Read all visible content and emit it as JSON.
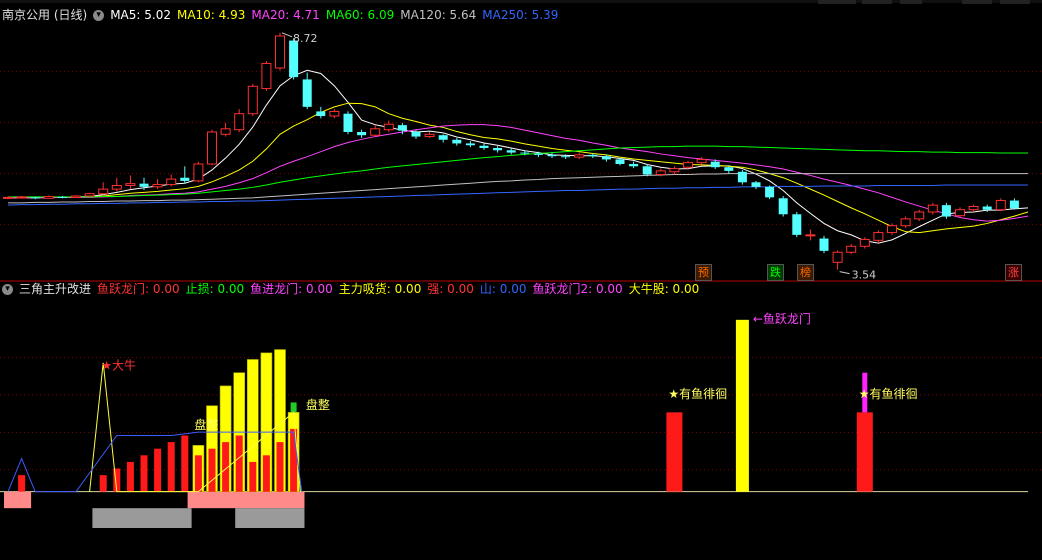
{
  "main_panel": {
    "stock_name": "南京公用 (日线)",
    "indicators": [
      {
        "label": "MA5: 5.02",
        "color": "#ffffff"
      },
      {
        "label": "MA10: 4.93",
        "color": "#ffff00"
      },
      {
        "label": "MA20: 4.71",
        "color": "#ff44ff"
      },
      {
        "label": "MA60: 6.09",
        "color": "#00ff00"
      },
      {
        "label": "MA120: 5.64",
        "color": "#c0c0c0"
      },
      {
        "label": "MA250: 5.39",
        "color": "#3366ff"
      }
    ],
    "high_label": "8.72",
    "low_label": "3.54",
    "signals": [
      {
        "text": "预",
        "color": "#ff6a00",
        "bg": "#3a1a00"
      },
      {
        "text": "跌",
        "color": "#00ff00",
        "bg": "#003a00"
      },
      {
        "text": "榜",
        "color": "#ff6a00",
        "bg": "#3a1a00"
      },
      {
        "text": "涨",
        "color": "#ff4444",
        "bg": "#3a0000"
      }
    ]
  },
  "sub_panel": {
    "name": "三角主升改进",
    "indicators": [
      {
        "label": "鱼跃龙门: 0.00",
        "color": "#ff3333"
      },
      {
        "label": "止损: 0.00",
        "color": "#00ff00"
      },
      {
        "label": "鱼进龙门: 0.00",
        "color": "#ff44ff"
      },
      {
        "label": "主力吸货: 0.00",
        "color": "#ffff00"
      },
      {
        "label": "强: 0.00",
        "color": "#ff3333"
      },
      {
        "label": "山: 0.00",
        "color": "#3366ff"
      },
      {
        "label": "鱼跃龙门2: 0.00",
        "color": "#ff44ff"
      },
      {
        "label": "大牛股: 0.00",
        "color": "#ffff00"
      }
    ],
    "annotations": {
      "da_niu": "★大牛",
      "pan_zheng_1": "盘整",
      "pan_zheng_2": "盘整",
      "yu_yue_long_men": "←鱼跃龙门",
      "you_yu_1": "★有鱼徘徊",
      "you_yu_2": "★有鱼徘徊"
    }
  },
  "colors": {
    "up": "#ff3030",
    "down": "#54ffff",
    "grid": "#7a0000",
    "axis": "#b40000"
  },
  "chart_data": {
    "type": "candlestick",
    "title": "南京公用 (日线)",
    "y_range": [
      3.4,
      9.0
    ],
    "candles": [
      {
        "o": 5.1,
        "c": 5.12,
        "h": 5.14,
        "l": 5.08
      },
      {
        "o": 5.11,
        "c": 5.13,
        "h": 5.15,
        "l": 5.09
      },
      {
        "o": 5.12,
        "c": 5.1,
        "h": 5.14,
        "l": 5.08
      },
      {
        "o": 5.1,
        "c": 5.14,
        "h": 5.16,
        "l": 5.09
      },
      {
        "o": 5.13,
        "c": 5.12,
        "h": 5.15,
        "l": 5.1
      },
      {
        "o": 5.12,
        "c": 5.15,
        "h": 5.17,
        "l": 5.11
      },
      {
        "o": 5.15,
        "c": 5.2,
        "h": 5.22,
        "l": 5.13
      },
      {
        "o": 5.2,
        "c": 5.3,
        "h": 5.45,
        "l": 5.18
      },
      {
        "o": 5.3,
        "c": 5.38,
        "h": 5.55,
        "l": 5.25
      },
      {
        "o": 5.38,
        "c": 5.42,
        "h": 5.6,
        "l": 5.3
      },
      {
        "o": 5.42,
        "c": 5.35,
        "h": 5.55,
        "l": 5.28
      },
      {
        "o": 5.35,
        "c": 5.4,
        "h": 5.52,
        "l": 5.3
      },
      {
        "o": 5.4,
        "c": 5.52,
        "h": 5.62,
        "l": 5.36
      },
      {
        "o": 5.55,
        "c": 5.48,
        "h": 5.8,
        "l": 5.42
      },
      {
        "o": 5.48,
        "c": 5.85,
        "h": 5.9,
        "l": 5.45
      },
      {
        "o": 5.85,
        "c": 6.55,
        "h": 6.6,
        "l": 5.82
      },
      {
        "o": 6.5,
        "c": 6.62,
        "h": 6.75,
        "l": 6.45
      },
      {
        "o": 6.6,
        "c": 6.95,
        "h": 7.05,
        "l": 6.55
      },
      {
        "o": 6.95,
        "c": 7.55,
        "h": 7.6,
        "l": 6.9
      },
      {
        "o": 7.5,
        "c": 8.05,
        "h": 8.1,
        "l": 7.45
      },
      {
        "o": 7.95,
        "c": 8.65,
        "h": 8.72,
        "l": 7.9
      },
      {
        "o": 8.55,
        "c": 7.75,
        "h": 8.6,
        "l": 7.7
      },
      {
        "o": 7.7,
        "c": 7.1,
        "h": 7.85,
        "l": 7.05
      },
      {
        "o": 7.0,
        "c": 6.9,
        "h": 7.1,
        "l": 6.85
      },
      {
        "o": 6.9,
        "c": 7.0,
        "h": 7.05,
        "l": 6.85
      },
      {
        "o": 6.95,
        "c": 6.55,
        "h": 7.0,
        "l": 6.5
      },
      {
        "o": 6.55,
        "c": 6.48,
        "h": 6.6,
        "l": 6.42
      },
      {
        "o": 6.48,
        "c": 6.62,
        "h": 6.7,
        "l": 6.45
      },
      {
        "o": 6.6,
        "c": 6.72,
        "h": 6.8,
        "l": 6.55
      },
      {
        "o": 6.7,
        "c": 6.58,
        "h": 6.75,
        "l": 6.5
      },
      {
        "o": 6.55,
        "c": 6.45,
        "h": 6.6,
        "l": 6.4
      },
      {
        "o": 6.45,
        "c": 6.5,
        "h": 6.55,
        "l": 6.42
      },
      {
        "o": 6.48,
        "c": 6.38,
        "h": 6.5,
        "l": 6.32
      },
      {
        "o": 6.38,
        "c": 6.3,
        "h": 6.42,
        "l": 6.25
      },
      {
        "o": 6.3,
        "c": 6.26,
        "h": 6.35,
        "l": 6.22
      },
      {
        "o": 6.25,
        "c": 6.2,
        "h": 6.3,
        "l": 6.16
      },
      {
        "o": 6.2,
        "c": 6.15,
        "h": 6.24,
        "l": 6.1
      },
      {
        "o": 6.15,
        "c": 6.1,
        "h": 6.2,
        "l": 6.06
      },
      {
        "o": 6.1,
        "c": 6.08,
        "h": 6.15,
        "l": 6.04
      },
      {
        "o": 6.08,
        "c": 6.05,
        "h": 6.12,
        "l": 6.0
      },
      {
        "o": 6.05,
        "c": 6.02,
        "h": 6.1,
        "l": 5.98
      },
      {
        "o": 6.02,
        "c": 6.0,
        "h": 6.06,
        "l": 5.96
      },
      {
        "o": 6.0,
        "c": 6.05,
        "h": 6.1,
        "l": 5.96
      },
      {
        "o": 6.05,
        "c": 6.02,
        "h": 6.08,
        "l": 5.98
      },
      {
        "o": 6.02,
        "c": 5.95,
        "h": 6.06,
        "l": 5.9
      },
      {
        "o": 5.95,
        "c": 5.85,
        "h": 5.98,
        "l": 5.82
      },
      {
        "o": 5.85,
        "c": 5.8,
        "h": 5.9,
        "l": 5.76
      },
      {
        "o": 5.8,
        "c": 5.62,
        "h": 5.85,
        "l": 5.58
      },
      {
        "o": 5.62,
        "c": 5.7,
        "h": 5.75,
        "l": 5.58
      },
      {
        "o": 5.68,
        "c": 5.75,
        "h": 5.8,
        "l": 5.62
      },
      {
        "o": 5.78,
        "c": 5.88,
        "h": 5.92,
        "l": 5.72
      },
      {
        "o": 5.88,
        "c": 5.95,
        "h": 6.0,
        "l": 5.84
      },
      {
        "o": 5.9,
        "c": 5.78,
        "h": 5.95,
        "l": 5.74
      },
      {
        "o": 5.78,
        "c": 5.7,
        "h": 5.82,
        "l": 5.65
      },
      {
        "o": 5.68,
        "c": 5.45,
        "h": 5.72,
        "l": 5.4
      },
      {
        "o": 5.45,
        "c": 5.35,
        "h": 5.48,
        "l": 5.3
      },
      {
        "o": 5.35,
        "c": 5.12,
        "h": 5.38,
        "l": 5.08
      },
      {
        "o": 5.1,
        "c": 4.75,
        "h": 5.15,
        "l": 4.7
      },
      {
        "o": 4.75,
        "c": 4.3,
        "h": 4.8,
        "l": 4.25
      },
      {
        "o": 4.3,
        "c": 4.3,
        "h": 4.42,
        "l": 4.18
      },
      {
        "o": 4.22,
        "c": 3.95,
        "h": 4.28,
        "l": 3.9
      },
      {
        "o": 3.7,
        "c": 3.92,
        "h": 3.96,
        "l": 3.54
      },
      {
        "o": 3.92,
        "c": 4.05,
        "h": 4.1,
        "l": 3.88
      },
      {
        "o": 4.05,
        "c": 4.2,
        "h": 4.25,
        "l": 4.0
      },
      {
        "o": 4.18,
        "c": 4.35,
        "h": 4.4,
        "l": 4.12
      },
      {
        "o": 4.35,
        "c": 4.5,
        "h": 4.55,
        "l": 4.3
      },
      {
        "o": 4.5,
        "c": 4.65,
        "h": 4.7,
        "l": 4.45
      },
      {
        "o": 4.65,
        "c": 4.8,
        "h": 4.85,
        "l": 4.6
      },
      {
        "o": 4.8,
        "c": 4.95,
        "h": 5.0,
        "l": 4.75
      },
      {
        "o": 4.95,
        "c": 4.7,
        "h": 5.0,
        "l": 4.65
      },
      {
        "o": 4.72,
        "c": 4.85,
        "h": 4.9,
        "l": 4.68
      },
      {
        "o": 4.85,
        "c": 4.92,
        "h": 4.96,
        "l": 4.8
      },
      {
        "o": 4.92,
        "c": 4.85,
        "h": 4.96,
        "l": 4.8
      },
      {
        "o": 4.85,
        "c": 5.05,
        "h": 5.1,
        "l": 4.82
      },
      {
        "o": 5.05,
        "c": 4.88,
        "h": 5.1,
        "l": 4.85
      }
    ],
    "ma_lines": [
      {
        "name": "MA5",
        "color": "#ffffff",
        "values": [
          5.11,
          5.12,
          5.12,
          5.12,
          5.12,
          5.13,
          5.14,
          5.18,
          5.23,
          5.29,
          5.33,
          5.37,
          5.41,
          5.43,
          5.52,
          5.72,
          5.98,
          6.28,
          6.66,
          7.14,
          7.56,
          7.78,
          7.9,
          7.83,
          7.56,
          7.2,
          6.81,
          6.71,
          6.65,
          6.59,
          6.55,
          6.57,
          6.53,
          6.44,
          6.38,
          6.31,
          6.26,
          6.2,
          6.14,
          6.1,
          6.05,
          6.04,
          6.03,
          6.03,
          6.01,
          5.97,
          5.93,
          5.84,
          5.78,
          5.74,
          5.75,
          5.8,
          5.81,
          5.81,
          5.75,
          5.63,
          5.48,
          5.27,
          5.0,
          4.77,
          4.55,
          4.39,
          4.3,
          4.17,
          4.12,
          4.19,
          4.33,
          4.48,
          4.62,
          4.76,
          4.79,
          4.8,
          4.84,
          4.84,
          4.87,
          4.89
        ]
      },
      {
        "name": "MA10",
        "color": "#ffff00",
        "values": [
          5.11,
          5.11,
          5.11,
          5.12,
          5.12,
          5.12,
          5.13,
          5.15,
          5.18,
          5.21,
          5.23,
          5.25,
          5.28,
          5.31,
          5.36,
          5.46,
          5.58,
          5.72,
          5.91,
          6.18,
          6.5,
          6.68,
          6.82,
          6.98,
          7.1,
          7.18,
          7.17,
          7.1,
          6.95,
          6.85,
          6.78,
          6.7,
          6.65,
          6.56,
          6.49,
          6.43,
          6.4,
          6.35,
          6.29,
          6.24,
          6.19,
          6.15,
          6.12,
          6.08,
          6.05,
          6.0,
          5.96,
          5.93,
          5.9,
          5.87,
          5.84,
          5.83,
          5.82,
          5.8,
          5.78,
          5.72,
          5.64,
          5.55,
          5.43,
          5.3,
          5.17,
          5.03,
          4.89,
          4.76,
          4.62,
          4.48,
          4.37,
          4.35,
          4.39,
          4.43,
          4.46,
          4.49,
          4.55,
          4.63,
          4.71,
          4.8
        ]
      },
      {
        "name": "MA20",
        "color": "#ff44ff",
        "values": [
          5.11,
          5.11,
          5.11,
          5.11,
          5.12,
          5.12,
          5.12,
          5.13,
          5.14,
          5.16,
          5.17,
          5.18,
          5.2,
          5.21,
          5.24,
          5.3,
          5.36,
          5.44,
          5.53,
          5.66,
          5.8,
          5.91,
          6.01,
          6.12,
          6.23,
          6.32,
          6.39,
          6.45,
          6.5,
          6.55,
          6.6,
          6.64,
          6.68,
          6.7,
          6.71,
          6.71,
          6.69,
          6.65,
          6.59,
          6.53,
          6.47,
          6.41,
          6.37,
          6.31,
          6.26,
          6.2,
          6.16,
          6.12,
          6.07,
          6.03,
          5.99,
          5.96,
          5.93,
          5.9,
          5.87,
          5.83,
          5.79,
          5.74,
          5.67,
          5.6,
          5.52,
          5.45,
          5.38,
          5.3,
          5.22,
          5.12,
          5.02,
          4.93,
          4.84,
          4.76,
          4.68,
          4.63,
          4.6,
          4.62,
          4.66,
          4.71
        ]
      },
      {
        "name": "MA60",
        "color": "#00ff00",
        "values": [
          5.13,
          5.13,
          5.13,
          5.13,
          5.13,
          5.13,
          5.13,
          5.14,
          5.14,
          5.15,
          5.16,
          5.17,
          5.18,
          5.19,
          5.21,
          5.24,
          5.27,
          5.3,
          5.34,
          5.39,
          5.45,
          5.5,
          5.55,
          5.59,
          5.63,
          5.67,
          5.7,
          5.74,
          5.78,
          5.81,
          5.84,
          5.87,
          5.9,
          5.93,
          5.96,
          5.99,
          6.01,
          6.04,
          6.06,
          6.08,
          6.1,
          6.12,
          6.14,
          6.16,
          6.18,
          6.2,
          6.21,
          6.22,
          6.23,
          6.23,
          6.24,
          6.24,
          6.24,
          6.23,
          6.23,
          6.22,
          6.21,
          6.2,
          6.19,
          6.18,
          6.17,
          6.16,
          6.15,
          6.14,
          6.14,
          6.13,
          6.12,
          6.12,
          6.11,
          6.11,
          6.1,
          6.1,
          6.1,
          6.09,
          6.09,
          6.09
        ]
      },
      {
        "name": "MA120",
        "color": "#c0c0c0",
        "values": [
          5.0,
          5.0,
          5.01,
          5.01,
          5.02,
          5.02,
          5.03,
          5.03,
          5.04,
          5.04,
          5.05,
          5.05,
          5.06,
          5.06,
          5.07,
          5.08,
          5.09,
          5.1,
          5.11,
          5.13,
          5.15,
          5.17,
          5.19,
          5.21,
          5.23,
          5.25,
          5.27,
          5.29,
          5.31,
          5.33,
          5.35,
          5.37,
          5.39,
          5.41,
          5.43,
          5.45,
          5.47,
          5.48,
          5.5,
          5.51,
          5.53,
          5.54,
          5.55,
          5.56,
          5.57,
          5.58,
          5.59,
          5.6,
          5.61,
          5.62,
          5.62,
          5.63,
          5.63,
          5.64,
          5.64,
          5.64,
          5.64,
          5.64,
          5.64,
          5.64,
          5.64,
          5.64,
          5.64,
          5.64,
          5.64,
          5.64,
          5.64,
          5.64,
          5.64,
          5.64,
          5.64,
          5.64,
          5.64,
          5.64,
          5.64,
          5.64
        ]
      },
      {
        "name": "MA250",
        "color": "#3366ff",
        "values": [
          4.95,
          4.96,
          4.96,
          4.97,
          4.97,
          4.98,
          4.98,
          4.99,
          4.99,
          5.0,
          5.0,
          5.01,
          5.01,
          5.02,
          5.02,
          5.03,
          5.03,
          5.04,
          5.04,
          5.05,
          5.06,
          5.07,
          5.08,
          5.09,
          5.1,
          5.11,
          5.12,
          5.13,
          5.14,
          5.15,
          5.16,
          5.17,
          5.18,
          5.19,
          5.2,
          5.21,
          5.22,
          5.23,
          5.24,
          5.25,
          5.26,
          5.27,
          5.27,
          5.28,
          5.29,
          5.3,
          5.3,
          5.31,
          5.32,
          5.32,
          5.33,
          5.33,
          5.34,
          5.34,
          5.35,
          5.35,
          5.35,
          5.36,
          5.36,
          5.36,
          5.37,
          5.37,
          5.37,
          5.37,
          5.38,
          5.38,
          5.38,
          5.38,
          5.38,
          5.39,
          5.39,
          5.39,
          5.39,
          5.39,
          5.39,
          5.39
        ]
      }
    ],
    "sub_series": {
      "red_bars": [
        {
          "i": 1,
          "v": 0.25
        },
        {
          "i": 7,
          "v": 0.25
        },
        {
          "i": 8,
          "v": 0.35
        },
        {
          "i": 9,
          "v": 0.45
        },
        {
          "i": 10,
          "v": 0.55
        },
        {
          "i": 11,
          "v": 0.65
        },
        {
          "i": 12,
          "v": 0.75
        },
        {
          "i": 13,
          "v": 0.85
        },
        {
          "i": 14,
          "v": 0.55
        },
        {
          "i": 15,
          "v": 0.65
        },
        {
          "i": 16,
          "v": 0.75
        },
        {
          "i": 17,
          "v": 0.85
        },
        {
          "i": 18,
          "v": 0.45
        },
        {
          "i": 19,
          "v": 0.55
        },
        {
          "i": 20,
          "v": 0.75
        },
        {
          "i": 21,
          "v": 0.95
        },
        {
          "i": 49,
          "v": 1.2
        },
        {
          "i": 63,
          "v": 1.2
        }
      ],
      "yellow_bars": [
        {
          "i": 14,
          "v": 0.7
        },
        {
          "i": 15,
          "v": 1.3
        },
        {
          "i": 16,
          "v": 1.6
        },
        {
          "i": 17,
          "v": 1.8
        },
        {
          "i": 18,
          "v": 2.0
        },
        {
          "i": 19,
          "v": 2.1
        },
        {
          "i": 20,
          "v": 2.15
        },
        {
          "i": 21,
          "v": 1.2
        },
        {
          "i": 54,
          "v": 2.6
        }
      ],
      "magenta_bars": [
        {
          "i": 63,
          "v": 0.6
        }
      ],
      "green_bars": [
        {
          "i": 21,
          "v": 0.15
        }
      ],
      "pink_base": [
        {
          "from": 0,
          "to": 1.7
        },
        {
          "from": 13.5,
          "to": 21.8
        }
      ],
      "gray_base": [
        {
          "from": 6.5,
          "to": 13.5
        },
        {
          "from": 17,
          "to": 21.8
        }
      ],
      "yellow_line": [
        [
          6,
          0.0
        ],
        [
          7,
          1.95
        ],
        [
          8,
          0.0
        ],
        [
          14,
          0.0
        ],
        [
          21,
          1.2
        ],
        [
          21.5,
          0.0
        ]
      ],
      "blue_line": [
        [
          0,
          0.0
        ],
        [
          1,
          0.5
        ],
        [
          2,
          0.0
        ],
        [
          5,
          0.0
        ],
        [
          8,
          0.85
        ],
        [
          12,
          0.85
        ],
        [
          14,
          0.9
        ],
        [
          21,
          0.9
        ],
        [
          21.6,
          0.0
        ]
      ]
    },
    "sub_range": [
      -0.55,
      2.9
    ]
  }
}
